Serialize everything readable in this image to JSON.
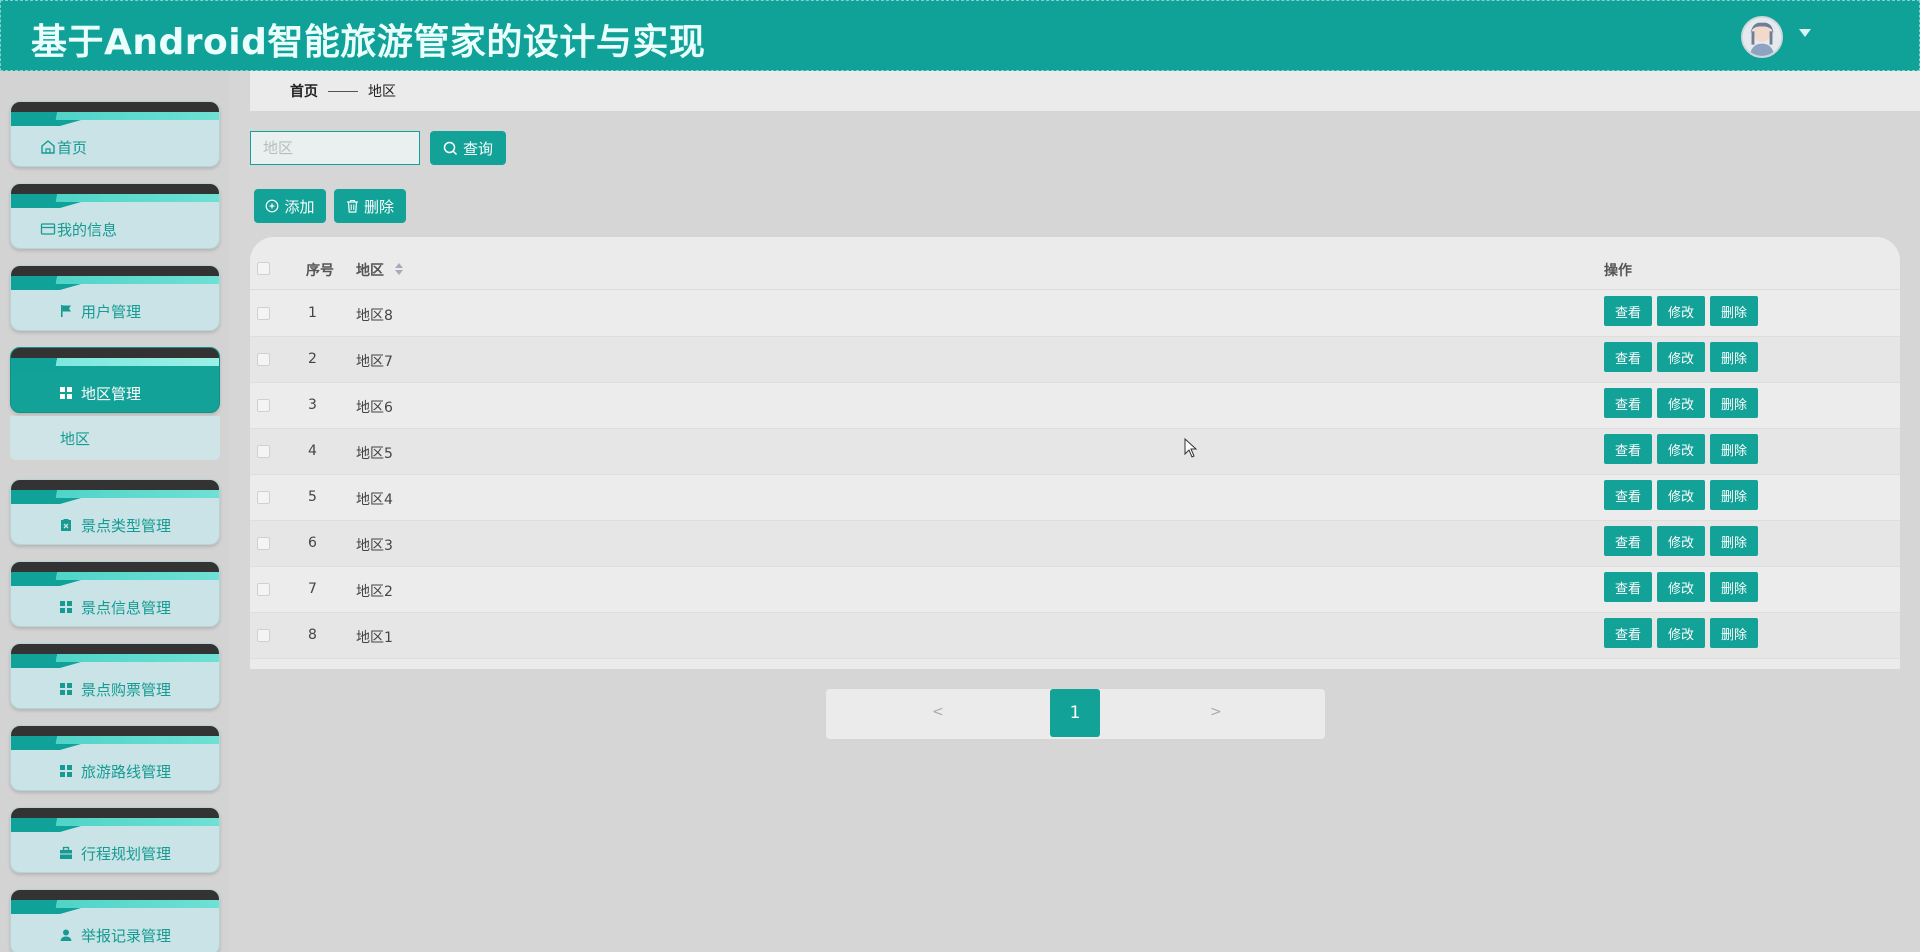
{
  "header": {
    "title": "基于Android智能旅游管家的设计与实现"
  },
  "sidebar": {
    "items": [
      {
        "label": "首页",
        "icon": "home-icon"
      },
      {
        "label": "我的信息",
        "icon": "card-icon"
      },
      {
        "label": "用户管理",
        "icon": "flag-icon"
      },
      {
        "label": "地区管理",
        "icon": "grid-icon",
        "active": true
      },
      {
        "label": "景点类型管理",
        "icon": "clipboard-icon"
      },
      {
        "label": "景点信息管理",
        "icon": "grid-icon"
      },
      {
        "label": "景点购票管理",
        "icon": "grid-icon"
      },
      {
        "label": "旅游路线管理",
        "icon": "grid-icon"
      },
      {
        "label": "行程规划管理",
        "icon": "briefcase-icon"
      },
      {
        "label": "举报记录管理",
        "icon": "user-icon"
      }
    ],
    "submenu": {
      "label": "地区"
    }
  },
  "breadcrumb": {
    "home": "首页",
    "current": "地区"
  },
  "search": {
    "placeholder": "地区",
    "button": "查询"
  },
  "toolbar": {
    "add": "添加",
    "delete": "删除"
  },
  "table": {
    "columns": {
      "index": "序号",
      "region": "地区",
      "actions": "操作"
    },
    "rows": [
      {
        "index": "1",
        "region": "地区8"
      },
      {
        "index": "2",
        "region": "地区7"
      },
      {
        "index": "3",
        "region": "地区6"
      },
      {
        "index": "4",
        "region": "地区5"
      },
      {
        "index": "5",
        "region": "地区4"
      },
      {
        "index": "6",
        "region": "地区3"
      },
      {
        "index": "7",
        "region": "地区2"
      },
      {
        "index": "8",
        "region": "地区1"
      }
    ],
    "row_actions": {
      "view": "查看",
      "edit": "修改",
      "delete": "删除"
    }
  },
  "pagination": {
    "prev": "<",
    "next": ">",
    "current": "1"
  },
  "colors": {
    "primary": "#13a298",
    "header": "#10a198"
  }
}
